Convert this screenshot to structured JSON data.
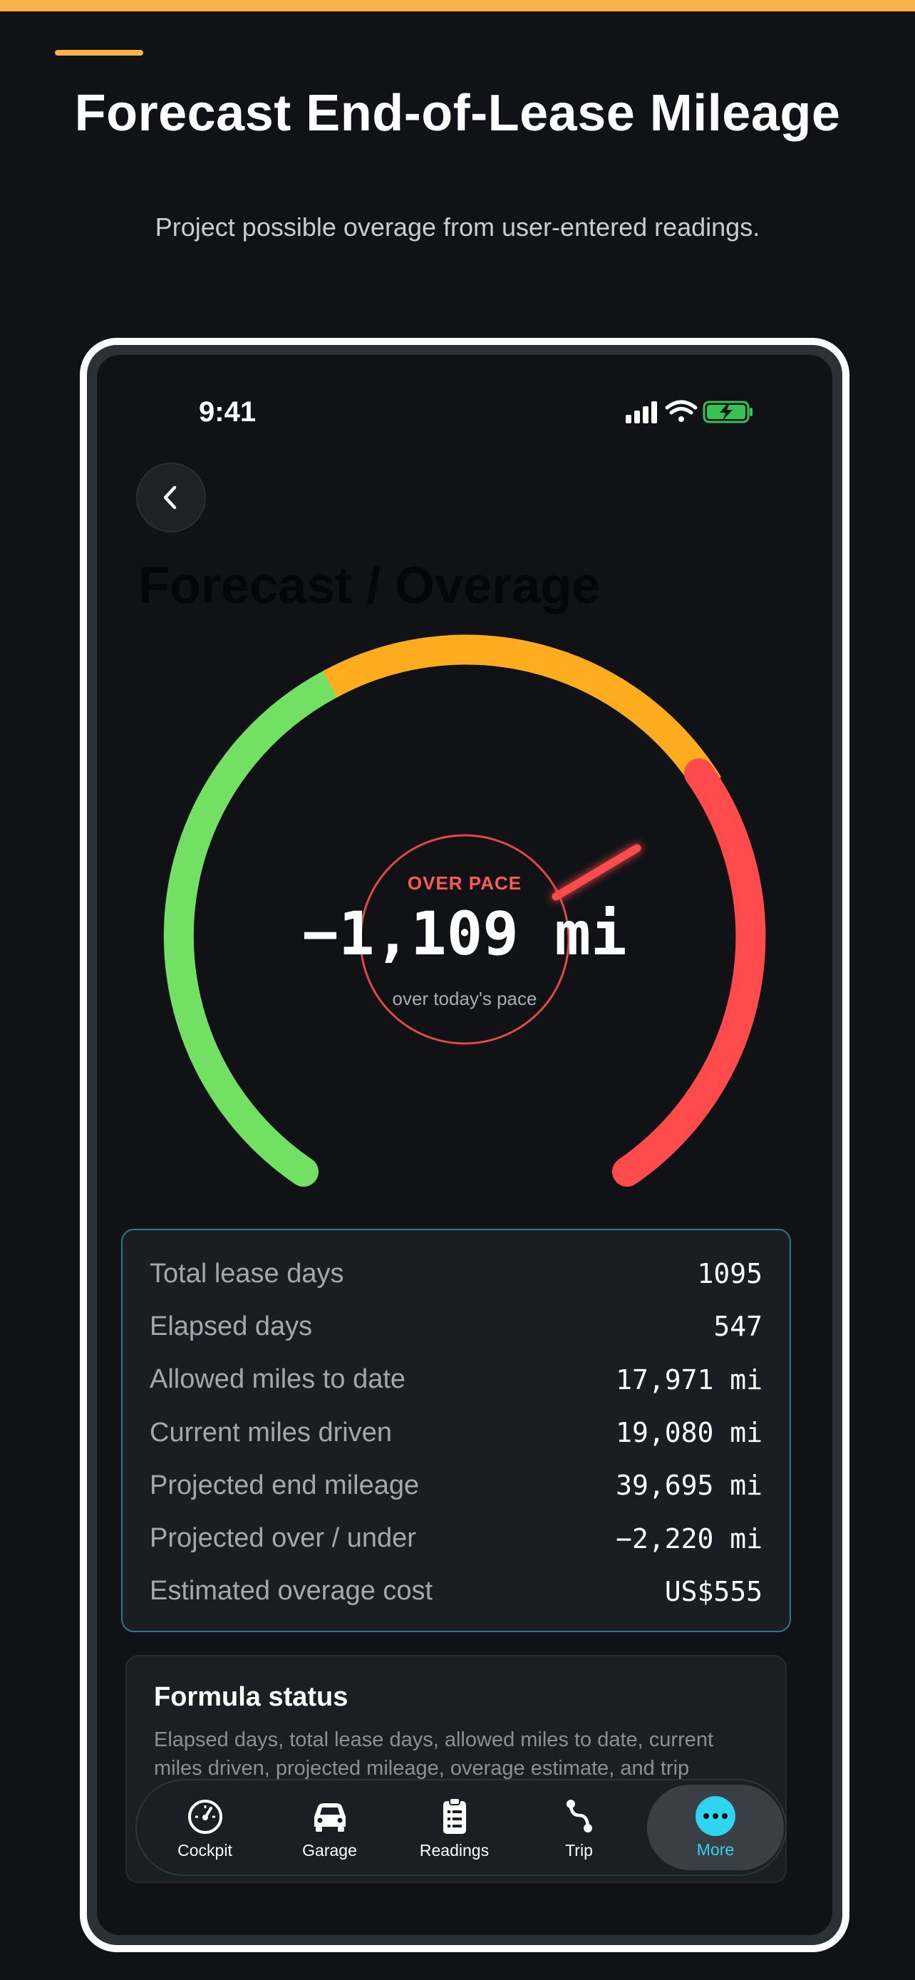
{
  "page": {
    "title": "Forecast End-of-Lease Mileage",
    "subtitle": "Project possible overage from user-entered readings."
  },
  "colors": {
    "accent": "#f7b24a",
    "gauge_green": "#72e063",
    "gauge_orange": "#ffad1f",
    "gauge_red": "#ff4b4b",
    "tab_active": "#2fd4ee",
    "card_border": "#2b7a87"
  },
  "status_bar": {
    "time": "9:41",
    "icons": [
      "signal-icon",
      "wifi-icon",
      "battery-charging-icon"
    ]
  },
  "screen": {
    "back_icon": "chevron-left-icon",
    "title": "Forecast / Overage"
  },
  "gauge": {
    "status": "OVER PACE",
    "value": "−1,109 mi",
    "caption": "over today's pace",
    "zones": [
      "green",
      "orange",
      "red"
    ]
  },
  "stats": [
    {
      "label": "Total lease days",
      "value": "1095"
    },
    {
      "label": "Elapsed days",
      "value": "547"
    },
    {
      "label": "Allowed miles to date",
      "value": "17,971 mi"
    },
    {
      "label": "Current miles driven",
      "value": "19,080 mi"
    },
    {
      "label": "Projected end mileage",
      "value": "39,695 mi"
    },
    {
      "label": "Projected over / under",
      "value": "−2,220 mi"
    },
    {
      "label": "Estimated overage cost",
      "value": "US$555"
    }
  ],
  "formula": {
    "title": "Formula status",
    "text": "Elapsed days, total lease days, allowed miles to date, current miles driven, projected mileage, overage estimate, and trip"
  },
  "tabs": [
    {
      "label": "Cockpit",
      "icon": "speedometer-icon"
    },
    {
      "label": "Garage",
      "icon": "car-icon"
    },
    {
      "label": "Readings",
      "icon": "clipboard-icon"
    },
    {
      "label": "Trip",
      "icon": "route-icon"
    },
    {
      "label": "More",
      "icon": "more-icon",
      "active": true
    }
  ]
}
